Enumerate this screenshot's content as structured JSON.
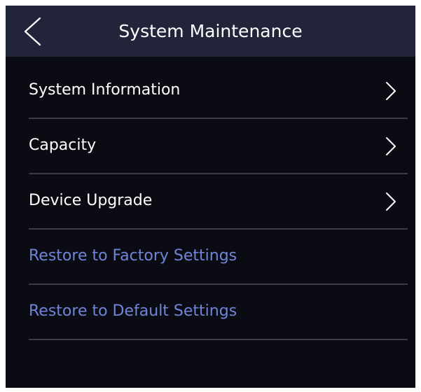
{
  "header": {
    "title": "System Maintenance",
    "back_icon": "chevron-left-icon"
  },
  "menu": {
    "items": [
      {
        "label": "System Information",
        "has_chevron": true
      },
      {
        "label": "Capacity",
        "has_chevron": true
      },
      {
        "label": "Device Upgrade",
        "has_chevron": true
      },
      {
        "label": "Restore to Factory Settings",
        "has_chevron": false
      },
      {
        "label": "Restore to Default Settings",
        "has_chevron": false
      }
    ]
  },
  "colors": {
    "background": "#0b0b14",
    "header_background": "#22253a",
    "text": "#ffffff",
    "action_text": "#6f86d8",
    "divider": "#3a3b45"
  }
}
